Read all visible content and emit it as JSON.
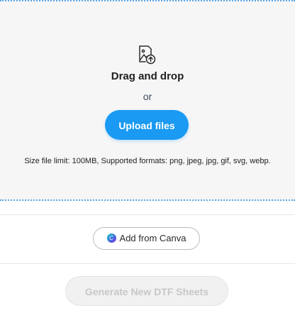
{
  "dropzone": {
    "title": "Drag and drop",
    "or_text": "or",
    "upload_label": "Upload files",
    "limits_text": "Size file limit: 100MB, Supported formats: png, jpeg, jpg, gif, svg, webp."
  },
  "canva": {
    "label": "Add from Canva",
    "logo_letter": "C"
  },
  "generate": {
    "label": "Generate New DTF Sheets"
  },
  "colors": {
    "accent": "#1a9af2",
    "dropzone_border": "#5aa7e6",
    "dropzone_bg": "#f6f6f7",
    "disabled_text": "#c7c7c7"
  },
  "icons": {
    "upload": "image-upload-icon",
    "canva": "canva-logo-icon"
  }
}
